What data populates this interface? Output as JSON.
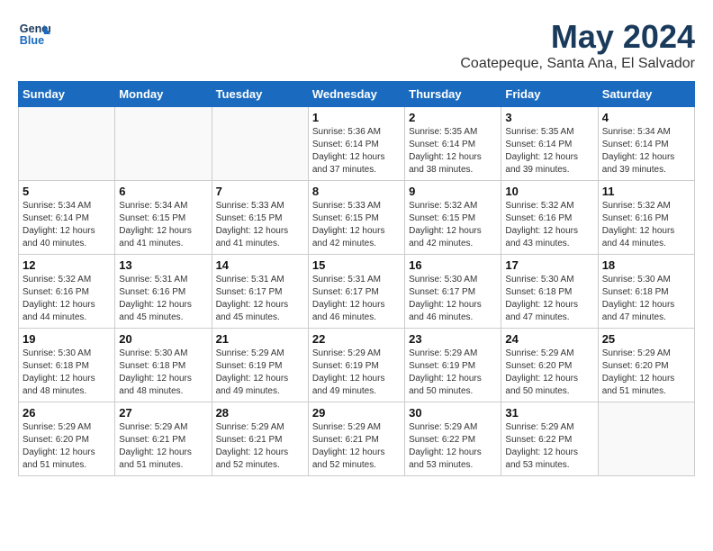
{
  "header": {
    "logo_line1": "General",
    "logo_line2": "Blue",
    "month": "May 2024",
    "location": "Coatepeque, Santa Ana, El Salvador"
  },
  "weekdays": [
    "Sunday",
    "Monday",
    "Tuesday",
    "Wednesday",
    "Thursday",
    "Friday",
    "Saturday"
  ],
  "weeks": [
    [
      {
        "day": "",
        "info": ""
      },
      {
        "day": "",
        "info": ""
      },
      {
        "day": "",
        "info": ""
      },
      {
        "day": "1",
        "info": "Sunrise: 5:36 AM\nSunset: 6:14 PM\nDaylight: 12 hours\nand 37 minutes."
      },
      {
        "day": "2",
        "info": "Sunrise: 5:35 AM\nSunset: 6:14 PM\nDaylight: 12 hours\nand 38 minutes."
      },
      {
        "day": "3",
        "info": "Sunrise: 5:35 AM\nSunset: 6:14 PM\nDaylight: 12 hours\nand 39 minutes."
      },
      {
        "day": "4",
        "info": "Sunrise: 5:34 AM\nSunset: 6:14 PM\nDaylight: 12 hours\nand 39 minutes."
      }
    ],
    [
      {
        "day": "5",
        "info": "Sunrise: 5:34 AM\nSunset: 6:14 PM\nDaylight: 12 hours\nand 40 minutes."
      },
      {
        "day": "6",
        "info": "Sunrise: 5:34 AM\nSunset: 6:15 PM\nDaylight: 12 hours\nand 41 minutes."
      },
      {
        "day": "7",
        "info": "Sunrise: 5:33 AM\nSunset: 6:15 PM\nDaylight: 12 hours\nand 41 minutes."
      },
      {
        "day": "8",
        "info": "Sunrise: 5:33 AM\nSunset: 6:15 PM\nDaylight: 12 hours\nand 42 minutes."
      },
      {
        "day": "9",
        "info": "Sunrise: 5:32 AM\nSunset: 6:15 PM\nDaylight: 12 hours\nand 42 minutes."
      },
      {
        "day": "10",
        "info": "Sunrise: 5:32 AM\nSunset: 6:16 PM\nDaylight: 12 hours\nand 43 minutes."
      },
      {
        "day": "11",
        "info": "Sunrise: 5:32 AM\nSunset: 6:16 PM\nDaylight: 12 hours\nand 44 minutes."
      }
    ],
    [
      {
        "day": "12",
        "info": "Sunrise: 5:32 AM\nSunset: 6:16 PM\nDaylight: 12 hours\nand 44 minutes."
      },
      {
        "day": "13",
        "info": "Sunrise: 5:31 AM\nSunset: 6:16 PM\nDaylight: 12 hours\nand 45 minutes."
      },
      {
        "day": "14",
        "info": "Sunrise: 5:31 AM\nSunset: 6:17 PM\nDaylight: 12 hours\nand 45 minutes."
      },
      {
        "day": "15",
        "info": "Sunrise: 5:31 AM\nSunset: 6:17 PM\nDaylight: 12 hours\nand 46 minutes."
      },
      {
        "day": "16",
        "info": "Sunrise: 5:30 AM\nSunset: 6:17 PM\nDaylight: 12 hours\nand 46 minutes."
      },
      {
        "day": "17",
        "info": "Sunrise: 5:30 AM\nSunset: 6:18 PM\nDaylight: 12 hours\nand 47 minutes."
      },
      {
        "day": "18",
        "info": "Sunrise: 5:30 AM\nSunset: 6:18 PM\nDaylight: 12 hours\nand 47 minutes."
      }
    ],
    [
      {
        "day": "19",
        "info": "Sunrise: 5:30 AM\nSunset: 6:18 PM\nDaylight: 12 hours\nand 48 minutes."
      },
      {
        "day": "20",
        "info": "Sunrise: 5:30 AM\nSunset: 6:18 PM\nDaylight: 12 hours\nand 48 minutes."
      },
      {
        "day": "21",
        "info": "Sunrise: 5:29 AM\nSunset: 6:19 PM\nDaylight: 12 hours\nand 49 minutes."
      },
      {
        "day": "22",
        "info": "Sunrise: 5:29 AM\nSunset: 6:19 PM\nDaylight: 12 hours\nand 49 minutes."
      },
      {
        "day": "23",
        "info": "Sunrise: 5:29 AM\nSunset: 6:19 PM\nDaylight: 12 hours\nand 50 minutes."
      },
      {
        "day": "24",
        "info": "Sunrise: 5:29 AM\nSunset: 6:20 PM\nDaylight: 12 hours\nand 50 minutes."
      },
      {
        "day": "25",
        "info": "Sunrise: 5:29 AM\nSunset: 6:20 PM\nDaylight: 12 hours\nand 51 minutes."
      }
    ],
    [
      {
        "day": "26",
        "info": "Sunrise: 5:29 AM\nSunset: 6:20 PM\nDaylight: 12 hours\nand 51 minutes."
      },
      {
        "day": "27",
        "info": "Sunrise: 5:29 AM\nSunset: 6:21 PM\nDaylight: 12 hours\nand 51 minutes."
      },
      {
        "day": "28",
        "info": "Sunrise: 5:29 AM\nSunset: 6:21 PM\nDaylight: 12 hours\nand 52 minutes."
      },
      {
        "day": "29",
        "info": "Sunrise: 5:29 AM\nSunset: 6:21 PM\nDaylight: 12 hours\nand 52 minutes."
      },
      {
        "day": "30",
        "info": "Sunrise: 5:29 AM\nSunset: 6:22 PM\nDaylight: 12 hours\nand 53 minutes."
      },
      {
        "day": "31",
        "info": "Sunrise: 5:29 AM\nSunset: 6:22 PM\nDaylight: 12 hours\nand 53 minutes."
      },
      {
        "day": "",
        "info": ""
      }
    ]
  ]
}
